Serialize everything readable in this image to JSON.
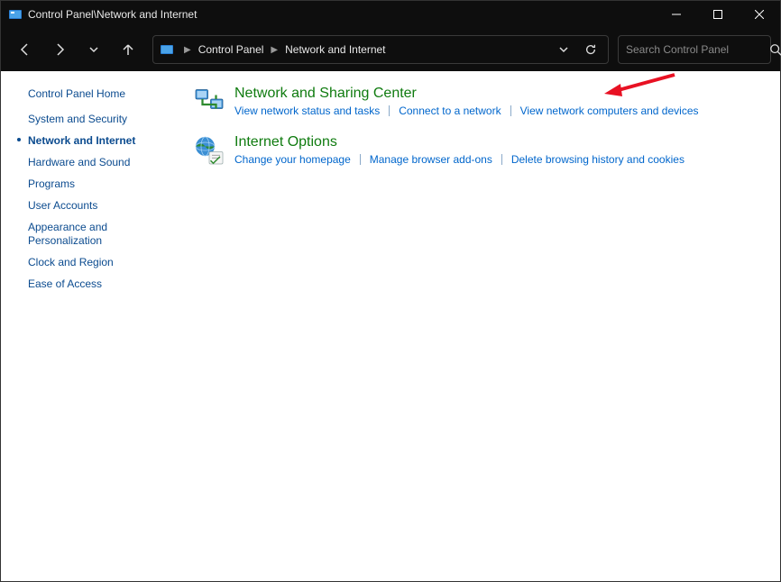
{
  "titlebar": {
    "title": "Control Panel\\Network and Internet"
  },
  "breadcrumb": {
    "items": [
      "Control Panel",
      "Network and Internet"
    ]
  },
  "search": {
    "placeholder": "Search Control Panel"
  },
  "sidebar": {
    "home": "Control Panel Home",
    "items": [
      {
        "label": "System and Security",
        "active": false
      },
      {
        "label": "Network and Internet",
        "active": true
      },
      {
        "label": "Hardware and Sound",
        "active": false
      },
      {
        "label": "Programs",
        "active": false
      },
      {
        "label": "User Accounts",
        "active": false
      },
      {
        "label": "Appearance and Personalization",
        "active": false
      },
      {
        "label": "Clock and Region",
        "active": false
      },
      {
        "label": "Ease of Access",
        "active": false
      }
    ]
  },
  "sections": [
    {
      "icon": "network-sharing-icon",
      "heading": "Network and Sharing Center",
      "links": [
        "View network status and tasks",
        "Connect to a network",
        "View network computers and devices"
      ]
    },
    {
      "icon": "internet-options-icon",
      "heading": "Internet Options",
      "links": [
        "Change your homepage",
        "Manage browser add-ons",
        "Delete browsing history and cookies"
      ]
    }
  ]
}
